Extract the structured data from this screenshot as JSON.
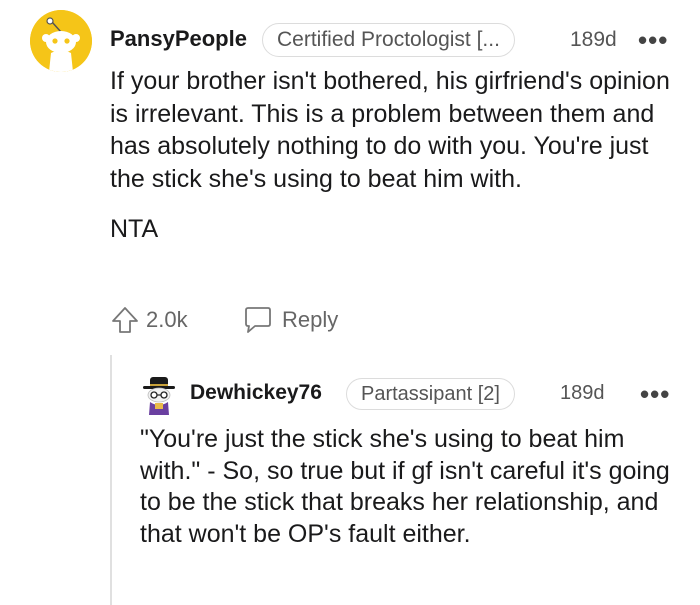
{
  "comment": {
    "username": "PansyPeople",
    "flair": "Certified Proctologist [...",
    "age": "189d",
    "more": "•••",
    "body": [
      "If your brother isn't bothered, his girfriend's opinion is irrelevant. This is a problem between them and has absolutely nothing to do with you. You're just the stick she's using to beat him with.",
      "NTA"
    ],
    "votes": "2.0k",
    "reply_label": "Reply",
    "avatar_color": "#f5c518"
  },
  "reply": {
    "username": "Dewhickey76",
    "flair": "Partassipant [2]",
    "age": "189d",
    "more": "•••",
    "body": "\"You're just the stick she's using to beat him with.\" - So, so true but if gf isn't careful it's going to be the stick that breaks her relationship, and that won't be OP's fault either."
  },
  "icons": {
    "upvote": "upvote-icon",
    "reply": "reply-bubble-icon",
    "more": "more-options-icon"
  }
}
